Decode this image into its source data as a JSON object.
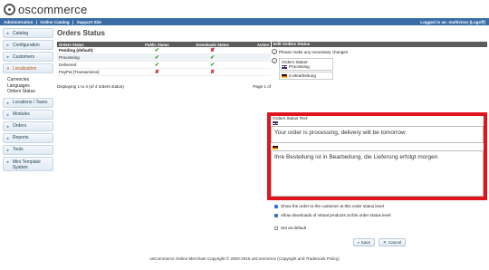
{
  "brand": "oscommerce",
  "topbar": {
    "links": [
      "Administration",
      "|",
      "Online Catalog",
      "|",
      "Support Site"
    ],
    "right": "Logged in as: multivisor (Logoff)"
  },
  "sidebar": {
    "items": [
      {
        "label": "Catalog"
      },
      {
        "label": "Configuration"
      },
      {
        "label": "Customers"
      },
      {
        "label": "Localization"
      },
      {
        "label": "Locations / Taxes"
      },
      {
        "label": "Modules"
      },
      {
        "label": "Orders"
      },
      {
        "label": "Reports"
      },
      {
        "label": "Tools"
      },
      {
        "label": "Mini Template System"
      }
    ],
    "submenu": [
      "Currencies",
      "Languages",
      "Orders Status"
    ]
  },
  "page_title": "Orders Status",
  "table": {
    "headers": [
      "Orders Status",
      "Public Status",
      "Downloads Status",
      "Action"
    ],
    "rows": [
      {
        "name": "Pending (default)",
        "public": "check",
        "downloads": "cross"
      },
      {
        "name": "Processing",
        "public": "check",
        "downloads": "check"
      },
      {
        "name": "Delivered",
        "public": "check",
        "downloads": "check"
      },
      {
        "name": "PayPal [Transactions]",
        "public": "cross",
        "downloads": "cross"
      }
    ],
    "pager_left": "Displaying 1 to 4 (of 4 orders status)",
    "pager_right": "Page 1 of"
  },
  "panel": {
    "title": "Edit Orders Status",
    "intro": "Please make any necessary changes",
    "orders_status_label": "Orders Status:",
    "status_en": "Processing",
    "status_de": "In Bearbeitung",
    "text_label": "Orders Status Text:",
    "text_en": "Your order is processing, delivery will be tomorrow",
    "text_de": "Ihre Bestellung ist in Bearbeitung, die Lieferung erfolgt morgen",
    "opt_show": "Show the order to the customer at this order status level",
    "opt_downloads": "Allow downloads of virtual products at this order status level",
    "opt_default": "Set as default",
    "save": "Save",
    "cancel": "Cancel"
  },
  "footer": "osCommerce Online Merchant Copyright © 2000-2015 osCommerce (Copyright and Trademark Policy)",
  "colors": {
    "topbar": "#3a6da8",
    "highlight": "#e0141b",
    "check": "#2a9a2a",
    "cross": "#c42121"
  }
}
